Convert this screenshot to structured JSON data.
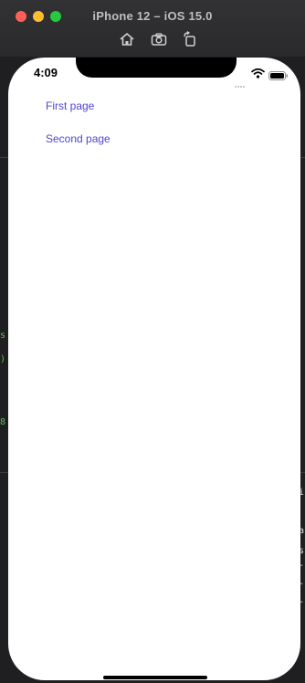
{
  "window": {
    "title": "iPhone 12 – iOS 15.0",
    "toolbar": [
      {
        "name": "home-icon"
      },
      {
        "name": "camera-icon"
      },
      {
        "name": "rotate-icon"
      }
    ],
    "traffic_colors": {
      "close": "#ff5f57",
      "minimize": "#febc2e",
      "maximize": "#28c840"
    }
  },
  "background_fragments": {
    "left": [
      "s",
      ")",
      "8"
    ],
    "right": [
      "i",
      "a",
      "s",
      "-",
      "-",
      "-"
    ]
  },
  "device": {
    "status_bar": {
      "time": "4:09"
    },
    "links": [
      {
        "label": "First page"
      },
      {
        "label": "Second page"
      }
    ],
    "link_color": "#4a46d6"
  }
}
